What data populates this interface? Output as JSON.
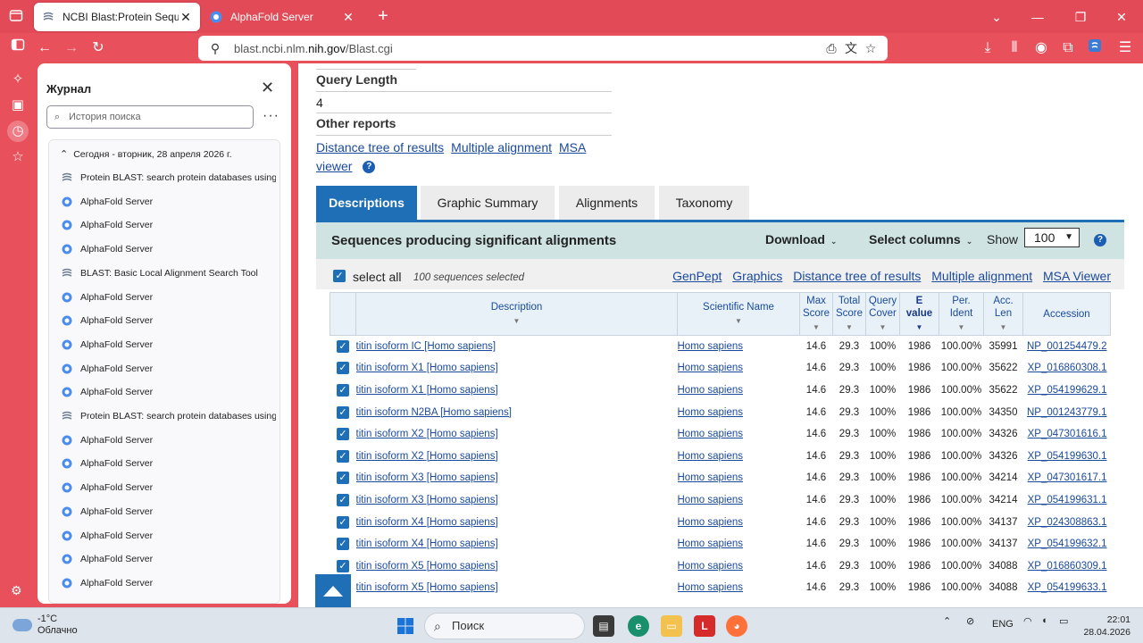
{
  "browser": {
    "tabs": [
      {
        "title": "NCBI Blast:Protein Sequence",
        "active": true
      },
      {
        "title": "AlphaFold Server",
        "active": false
      }
    ],
    "url_prefix": "blast.ncbi.nlm.",
    "url_domain": "nih.gov",
    "url_path": "/Blast.cgi"
  },
  "history": {
    "title": "Журнал",
    "search_placeholder": "История поиска",
    "date_header": "Сегодня - вторник, 28 апреля 2026 г.",
    "items": [
      {
        "label": "Protein BLAST: search protein databases using ...",
        "icon": "ncbi"
      },
      {
        "label": "AlphaFold Server",
        "icon": "alphafold"
      },
      {
        "label": "AlphaFold Server",
        "icon": "alphafold"
      },
      {
        "label": "AlphaFold Server",
        "icon": "alphafold"
      },
      {
        "label": "BLAST: Basic Local Alignment Search Tool",
        "icon": "ncbi"
      },
      {
        "label": "AlphaFold Server",
        "icon": "alphafold"
      },
      {
        "label": "AlphaFold Server",
        "icon": "alphafold"
      },
      {
        "label": "AlphaFold Server",
        "icon": "alphafold"
      },
      {
        "label": "AlphaFold Server",
        "icon": "alphafold"
      },
      {
        "label": "AlphaFold Server",
        "icon": "alphafold"
      },
      {
        "label": "Protein BLAST: search protein databases using ...",
        "icon": "ncbi"
      },
      {
        "label": "AlphaFold Server",
        "icon": "alphafold"
      },
      {
        "label": "AlphaFold Server",
        "icon": "alphafold"
      },
      {
        "label": "AlphaFold Server",
        "icon": "alphafold"
      },
      {
        "label": "AlphaFold Server",
        "icon": "alphafold"
      },
      {
        "label": "AlphaFold Server",
        "icon": "alphafold"
      },
      {
        "label": "AlphaFold Server",
        "icon": "alphafold"
      },
      {
        "label": "AlphaFold Server",
        "icon": "alphafold"
      }
    ]
  },
  "page": {
    "query_length_label": "Query Length",
    "query_length_value": "4",
    "other_reports_label": "Other reports",
    "reports": [
      "Distance tree of results",
      "Multiple alignment",
      "MSA",
      "viewer"
    ],
    "result_tabs": [
      "Descriptions",
      "Graphic Summary",
      "Alignments",
      "Taxonomy"
    ],
    "seq_title": "Sequences producing significant alignments",
    "download_label": "Download",
    "select_columns_label": "Select columns",
    "show_label": "Show",
    "show_value": "100",
    "select_all_label": "select all",
    "selected_count": "100 sequences selected",
    "action_links": [
      "GenPept",
      "Graphics",
      "Distance tree of results",
      "Multiple alignment",
      "MSA Viewer"
    ],
    "columns": {
      "description": "Description",
      "scientific_name": "Scientific Name",
      "max_score": [
        "Max",
        "Score"
      ],
      "total_score": [
        "Total",
        "Score"
      ],
      "query_cover": [
        "Query",
        "Cover"
      ],
      "e_value": [
        "E",
        "value"
      ],
      "per_ident": [
        "Per.",
        "Ident"
      ],
      "acc_len": [
        "Acc.",
        "Len"
      ],
      "accession": "Accession"
    },
    "rows": [
      {
        "description": "titin isoform IC [Homo sapiens]",
        "scientific_name": "Homo sapiens",
        "max_score": "14.6",
        "total_score": "29.3",
        "query_cover": "100%",
        "e_value": "1986",
        "per_ident": "100.00%",
        "acc_len": "35991",
        "accession": "NP_001254479.2"
      },
      {
        "description": "titin isoform X1 [Homo sapiens]",
        "scientific_name": "Homo sapiens",
        "max_score": "14.6",
        "total_score": "29.3",
        "query_cover": "100%",
        "e_value": "1986",
        "per_ident": "100.00%",
        "acc_len": "35622",
        "accession": "XP_016860308.1"
      },
      {
        "description": "titin isoform X1 [Homo sapiens]",
        "scientific_name": "Homo sapiens",
        "max_score": "14.6",
        "total_score": "29.3",
        "query_cover": "100%",
        "e_value": "1986",
        "per_ident": "100.00%",
        "acc_len": "35622",
        "accession": "XP_054199629.1"
      },
      {
        "description": "titin isoform N2BA [Homo sapiens]",
        "scientific_name": "Homo sapiens",
        "max_score": "14.6",
        "total_score": "29.3",
        "query_cover": "100%",
        "e_value": "1986",
        "per_ident": "100.00%",
        "acc_len": "34350",
        "accession": "NP_001243779.1"
      },
      {
        "description": "titin isoform X2 [Homo sapiens]",
        "scientific_name": "Homo sapiens",
        "max_score": "14.6",
        "total_score": "29.3",
        "query_cover": "100%",
        "e_value": "1986",
        "per_ident": "100.00%",
        "acc_len": "34326",
        "accession": "XP_047301616.1"
      },
      {
        "description": "titin isoform X2 [Homo sapiens]",
        "scientific_name": "Homo sapiens",
        "max_score": "14.6",
        "total_score": "29.3",
        "query_cover": "100%",
        "e_value": "1986",
        "per_ident": "100.00%",
        "acc_len": "34326",
        "accession": "XP_054199630.1"
      },
      {
        "description": "titin isoform X3 [Homo sapiens]",
        "scientific_name": "Homo sapiens",
        "max_score": "14.6",
        "total_score": "29.3",
        "query_cover": "100%",
        "e_value": "1986",
        "per_ident": "100.00%",
        "acc_len": "34214",
        "accession": "XP_047301617.1"
      },
      {
        "description": "titin isoform X3 [Homo sapiens]",
        "scientific_name": "Homo sapiens",
        "max_score": "14.6",
        "total_score": "29.3",
        "query_cover": "100%",
        "e_value": "1986",
        "per_ident": "100.00%",
        "acc_len": "34214",
        "accession": "XP_054199631.1"
      },
      {
        "description": "titin isoform X4 [Homo sapiens]",
        "scientific_name": "Homo sapiens",
        "max_score": "14.6",
        "total_score": "29.3",
        "query_cover": "100%",
        "e_value": "1986",
        "per_ident": "100.00%",
        "acc_len": "34137",
        "accession": "XP_024308863.1"
      },
      {
        "description": "titin isoform X4 [Homo sapiens]",
        "scientific_name": "Homo sapiens",
        "max_score": "14.6",
        "total_score": "29.3",
        "query_cover": "100%",
        "e_value": "1986",
        "per_ident": "100.00%",
        "acc_len": "34137",
        "accession": "XP_054199632.1"
      },
      {
        "description": "titin isoform X5 [Homo sapiens]",
        "scientific_name": "Homo sapiens",
        "max_score": "14.6",
        "total_score": "29.3",
        "query_cover": "100%",
        "e_value": "1986",
        "per_ident": "100.00%",
        "acc_len": "34088",
        "accession": "XP_016860309.1"
      },
      {
        "description": "titin isoform X5 [Homo sapiens]",
        "scientific_name": "Homo sapiens",
        "max_score": "14.6",
        "total_score": "29.3",
        "query_cover": "100%",
        "e_value": "1986",
        "per_ident": "100.00%",
        "acc_len": "34088",
        "accession": "XP_054199633.1"
      }
    ]
  },
  "taskbar": {
    "temperature": "-1°C",
    "weather_desc": "Облачно",
    "search_label": "Поиск",
    "lang": "ENG",
    "time": "22:01",
    "date": "28.04.2026"
  },
  "colors": {
    "browser_accent": "#e8505b",
    "ncbi_blue": "#1e6fb5",
    "link_blue": "#1a4a9c",
    "seq_header_bg": "#cfe3e3"
  }
}
